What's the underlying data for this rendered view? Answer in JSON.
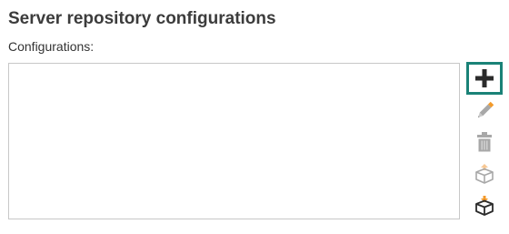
{
  "panel": {
    "title": "Server repository configurations",
    "configurations_label": "Configurations:"
  },
  "configurations": {
    "items": []
  },
  "toolbar": {
    "buttons": [
      {
        "name": "add",
        "icon": "plus-icon",
        "enabled": true,
        "focused": true
      },
      {
        "name": "edit",
        "icon": "pencil-icon",
        "enabled": false
      },
      {
        "name": "delete",
        "icon": "trash-icon",
        "enabled": false
      },
      {
        "name": "export",
        "icon": "box-export-icon",
        "enabled": false
      },
      {
        "name": "import",
        "icon": "box-import-icon",
        "enabled": true
      }
    ]
  },
  "colors": {
    "focus_border": "#1a8277",
    "icon_enabled": "#2b2b2b",
    "icon_disabled": "#a8a8a8",
    "accent_orange": "#f39a2b",
    "list_border": "#c8c8c8"
  }
}
